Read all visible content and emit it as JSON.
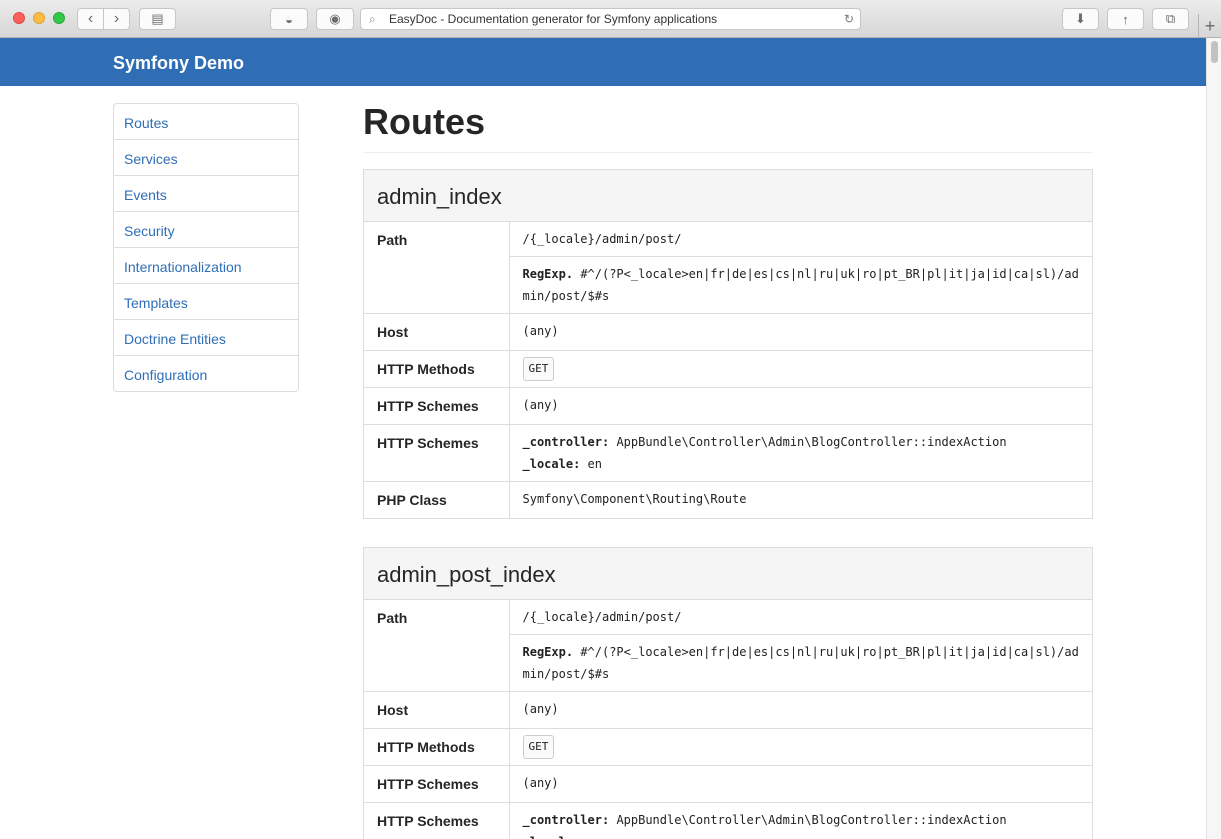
{
  "browser": {
    "url_title": "EasyDoc - Documentation generator for Symfony applications"
  },
  "navbar": {
    "brand": "Symfony Demo"
  },
  "sidebar": {
    "items": [
      {
        "label": "Routes"
      },
      {
        "label": "Services"
      },
      {
        "label": "Events"
      },
      {
        "label": "Security"
      },
      {
        "label": "Internationalization"
      },
      {
        "label": "Templates"
      },
      {
        "label": "Doctrine Entities"
      },
      {
        "label": "Configuration"
      }
    ]
  },
  "main": {
    "title": "Routes",
    "labels": {
      "path": "Path",
      "host": "Host",
      "methods": "HTTP Methods",
      "schemes": "HTTP Schemes",
      "defaults": "HTTP Schemes",
      "php_class": "PHP Class",
      "regexp_prefix": "RegExp.",
      "controller_key": "_controller:",
      "locale_key": "_locale:"
    },
    "routes": [
      {
        "name": "admin_index",
        "path": "/{_locale}/admin/post/",
        "regexp": "#^/(?P<_locale>en|fr|de|es|cs|nl|ru|uk|ro|pt_BR|pl|it|ja|id|ca|sl)/admin/post/$#s",
        "host": "(any)",
        "method": "GET",
        "schemes": "(any)",
        "controller": "AppBundle\\Controller\\Admin\\BlogController::indexAction",
        "locale": "en",
        "php_class": "Symfony\\Component\\Routing\\Route"
      },
      {
        "name": "admin_post_index",
        "path": "/{_locale}/admin/post/",
        "regexp": "#^/(?P<_locale>en|fr|de|es|cs|nl|ru|uk|ro|pt_BR|pl|it|ja|id|ca|sl)/admin/post/$#s",
        "host": "(any)",
        "method": "GET",
        "schemes": "(any)",
        "controller": "AppBundle\\Controller\\Admin\\BlogController::indexAction",
        "locale": "en"
      }
    ]
  }
}
